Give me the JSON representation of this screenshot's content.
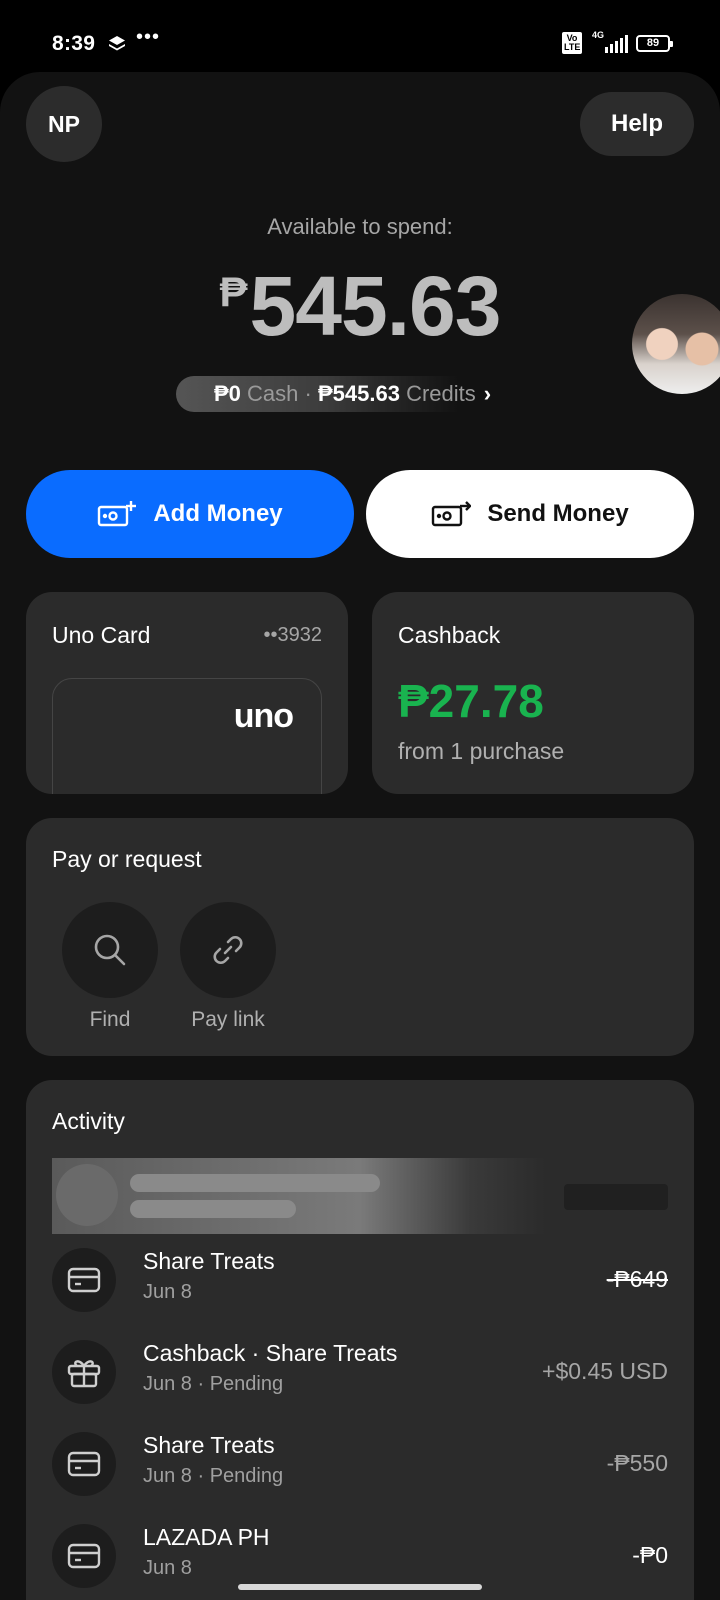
{
  "status_bar": {
    "time": "8:39",
    "more": "•••",
    "volte": "Vo LTE",
    "network": "4G",
    "battery": "89"
  },
  "header": {
    "avatar_initials": "NP",
    "help_label": "Help"
  },
  "balance": {
    "label": "Available to spend:",
    "currency": "₱",
    "amount": "545.63",
    "cash_amount": "₱0",
    "cash_label": "Cash ·",
    "credits_amount": "₱545.63",
    "credits_label": "Credits",
    "chevron": "›"
  },
  "actions": {
    "add_money": "Add Money",
    "send_money": "Send Money",
    "add_icon": "wallet-add-icon",
    "send_icon": "wallet-send-icon"
  },
  "uno_card": {
    "title": "Uno Card",
    "number": "••3932",
    "logo": "uno"
  },
  "cashback": {
    "title": "Cashback",
    "amount": "₱27.78",
    "subtitle": "from 1 purchase",
    "accent_color": "#19b34f"
  },
  "pay_or_request": {
    "title": "Pay or request",
    "options": [
      {
        "label": "Find",
        "icon": "search-icon"
      },
      {
        "label": "Pay link",
        "icon": "link-icon"
      }
    ]
  },
  "activity": {
    "title": "Activity",
    "transactions": [
      {
        "title": "Share Treats",
        "subtitle": "Jun 8",
        "amount": "-₱649",
        "icon": "card-icon"
      },
      {
        "title": "Cashback · Share Treats",
        "subtitle": "Jun 8 · Pending",
        "amount": "+$0.45 USD",
        "icon": "gift-icon"
      },
      {
        "title": "Share Treats",
        "subtitle": "Jun 8 · Pending",
        "amount": "-₱550",
        "icon": "card-icon"
      },
      {
        "title": "LAZADA PH",
        "subtitle": "Jun 8",
        "amount": "-₱0",
        "icon": "card-icon"
      }
    ]
  },
  "colors": {
    "background": "#121212",
    "card": "#2b2b2b",
    "primary_button": "#0a6cff"
  }
}
